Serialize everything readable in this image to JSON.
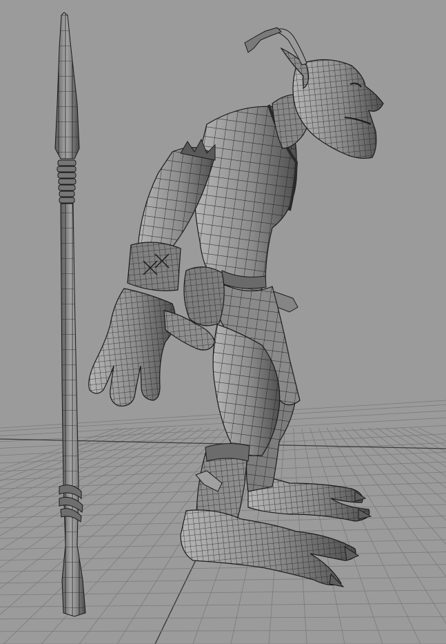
{
  "viewport": {
    "view": "perspective",
    "shading": "wireframe-on-shaded",
    "grid": true
  },
  "colors": {
    "background": "#9b9b9b",
    "grid": "#7a7a7a",
    "grid_axis": "#3a3a3a",
    "mesh_fill": "#8a8a8a",
    "mesh_shadow": "#4a4a4a",
    "mesh_light": "#b8b8b8",
    "wire": "#1a1a1a"
  },
  "scene": {
    "objects": [
      {
        "name": "spear",
        "type": "mesh"
      },
      {
        "name": "goblin-character",
        "type": "mesh"
      }
    ]
  }
}
